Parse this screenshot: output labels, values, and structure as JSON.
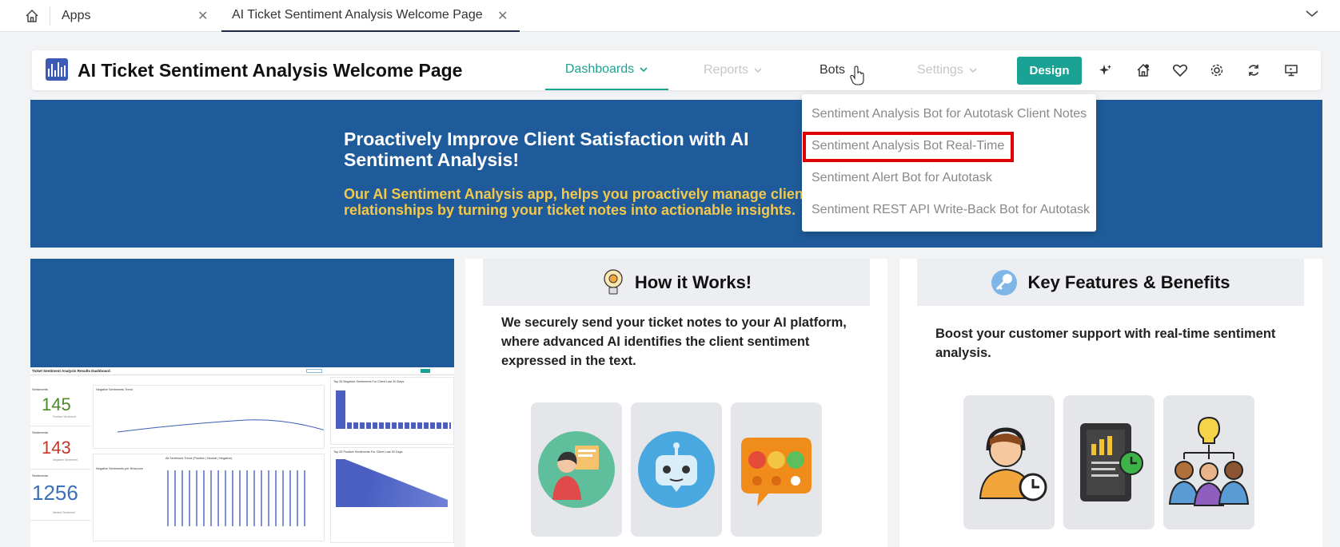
{
  "tabs": {
    "apps_label": "Apps",
    "active_label": "AI Ticket Sentiment Analysis Welcome Page"
  },
  "header": {
    "title": "AI Ticket Sentiment Analysis Welcome Page",
    "nav": {
      "dashboards": "Dashboards",
      "reports": "Reports",
      "bots": "Bots",
      "settings": "Settings"
    },
    "design_label": "Design",
    "icons": [
      "sparkle-icon",
      "home-settings-icon",
      "heart-icon",
      "gear-icon",
      "refresh-icon",
      "monitor-icon"
    ]
  },
  "bots_menu": {
    "items": [
      "Sentiment Analysis Bot for Autotask Client Notes",
      "Sentiment Analysis Bot Real-Time",
      "Sentiment Alert Bot for Autotask",
      "Sentiment REST API Write-Back Bot for Autotask"
    ],
    "highlighted_index": 1
  },
  "banner": {
    "heading": "Proactively Improve Client Satisfaction with AI Sentiment Analysis!",
    "text": "Our AI Sentiment Analysis app, helps you proactively manage client relationships by turning your ticket notes into actionable insights."
  },
  "how": {
    "title": "How it Works!",
    "text": "We securely send your ticket notes to your AI platform, where advanced AI identifies the client sentiment expressed in the text."
  },
  "features": {
    "title": "Key Features & Benefits",
    "text": "Boost your customer support with real-time sentiment analysis."
  },
  "dashboard_preview": {
    "title": "Ticket Sentiment Analysis Results Dashboard",
    "kpis": [
      {
        "label": "Sentiments",
        "value": "145",
        "sub": "Positive Sentiment",
        "color": "#4d8a2a"
      },
      {
        "label": "Sentiments",
        "value": "143",
        "sub": "Negative Sentiment",
        "color": "#c0392b"
      },
      {
        "label": "Sentiments",
        "value": "1256",
        "sub": "Neutral Sentiment",
        "color": "#3b6fb6"
      }
    ],
    "panels": {
      "trend": "Negative Sentiments Trend",
      "top_neg": "Top 25 Negative Sentiments For Client Last 30 Days",
      "top_pos": "Top 25 Positive Sentiments For Client Last 30 Days",
      "by_day": "All Sentiment Trend (Positive | Neutral | Negative)",
      "by_assignee": "Negative Sentiments per Resource"
    }
  },
  "colors": {
    "teal": "#1aa394",
    "banner_blue": "#1f5b9a",
    "banner_yellow": "#f4c84a",
    "highlight_red": "#e00000"
  }
}
